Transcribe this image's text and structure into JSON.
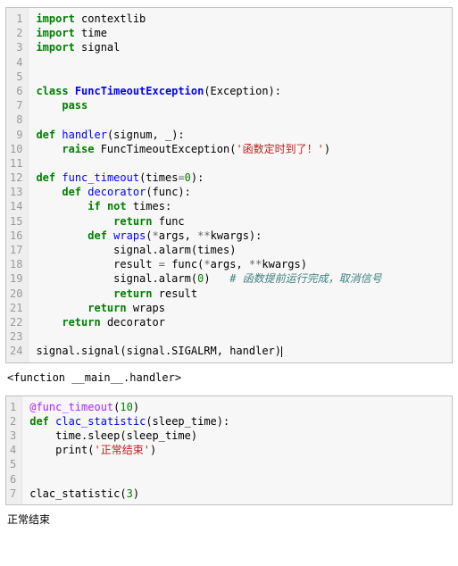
{
  "cells": [
    {
      "lines": [
        [
          [
            "kw",
            "import"
          ],
          [
            "pl",
            " contextlib"
          ]
        ],
        [
          [
            "kw",
            "import"
          ],
          [
            "pl",
            " time"
          ]
        ],
        [
          [
            "kw",
            "import"
          ],
          [
            "pl",
            " signal"
          ]
        ],
        [],
        [],
        [
          [
            "kw",
            "class"
          ],
          [
            "pl",
            " "
          ],
          [
            "cls",
            "FuncTimeoutException"
          ],
          [
            "pl",
            "(Exception):"
          ]
        ],
        [
          [
            "pl",
            "    "
          ],
          [
            "kw",
            "pass"
          ]
        ],
        [],
        [
          [
            "kw",
            "def"
          ],
          [
            "pl",
            " "
          ],
          [
            "fn",
            "handler"
          ],
          [
            "pl",
            "(signum, _):"
          ]
        ],
        [
          [
            "pl",
            "    "
          ],
          [
            "kw",
            "raise"
          ],
          [
            "pl",
            " FuncTimeoutException("
          ],
          [
            "str",
            "'函数定时到了！'"
          ],
          [
            "pl",
            ")"
          ]
        ],
        [],
        [
          [
            "kw",
            "def"
          ],
          [
            "pl",
            " "
          ],
          [
            "fn",
            "func_timeout"
          ],
          [
            "pl",
            "(times"
          ],
          [
            "op",
            "="
          ],
          [
            "num",
            "0"
          ],
          [
            "pl",
            "):"
          ]
        ],
        [
          [
            "pl",
            "    "
          ],
          [
            "kw",
            "def"
          ],
          [
            "pl",
            " "
          ],
          [
            "fn",
            "decorator"
          ],
          [
            "pl",
            "(func):"
          ]
        ],
        [
          [
            "pl",
            "        "
          ],
          [
            "kw",
            "if"
          ],
          [
            "pl",
            " "
          ],
          [
            "kw",
            "not"
          ],
          [
            "pl",
            " times:"
          ]
        ],
        [
          [
            "pl",
            "            "
          ],
          [
            "kw",
            "return"
          ],
          [
            "pl",
            " func"
          ]
        ],
        [
          [
            "pl",
            "        "
          ],
          [
            "kw",
            "def"
          ],
          [
            "pl",
            " "
          ],
          [
            "fn",
            "wraps"
          ],
          [
            "pl",
            "("
          ],
          [
            "op",
            "*"
          ],
          [
            "pl",
            "args, "
          ],
          [
            "op",
            "**"
          ],
          [
            "pl",
            "kwargs):"
          ]
        ],
        [
          [
            "pl",
            "            signal.alarm(times)"
          ]
        ],
        [
          [
            "pl",
            "            result "
          ],
          [
            "op",
            "="
          ],
          [
            "pl",
            " func("
          ],
          [
            "op",
            "*"
          ],
          [
            "pl",
            "args, "
          ],
          [
            "op",
            "**"
          ],
          [
            "pl",
            "kwargs)"
          ]
        ],
        [
          [
            "pl",
            "            signal.alarm("
          ],
          [
            "num",
            "0"
          ],
          [
            "pl",
            ")   "
          ],
          [
            "cmt",
            "# 函数提前运行完成，取消信号"
          ]
        ],
        [
          [
            "pl",
            "            "
          ],
          [
            "kw",
            "return"
          ],
          [
            "pl",
            " result"
          ]
        ],
        [
          [
            "pl",
            "        "
          ],
          [
            "kw",
            "return"
          ],
          [
            "pl",
            " wraps"
          ]
        ],
        [
          [
            "pl",
            "    "
          ],
          [
            "kw",
            "return"
          ],
          [
            "pl",
            " decorator"
          ]
        ],
        [],
        [
          [
            "pl",
            "signal.signal(signal.SIGALRM, handler)"
          ],
          [
            "cursor",
            ""
          ]
        ]
      ],
      "output": "<function __main__.handler>"
    },
    {
      "lines": [
        [
          [
            "dec",
            "@func_timeout"
          ],
          [
            "pl",
            "("
          ],
          [
            "num",
            "10"
          ],
          [
            "pl",
            ")"
          ]
        ],
        [
          [
            "kw",
            "def"
          ],
          [
            "pl",
            " "
          ],
          [
            "fn",
            "clac_statistic"
          ],
          [
            "pl",
            "(sleep_time):"
          ]
        ],
        [
          [
            "pl",
            "    time.sleep(sleep_time)"
          ]
        ],
        [
          [
            "pl",
            "    print("
          ],
          [
            "str",
            "'正常结束'"
          ],
          [
            "pl",
            ")"
          ]
        ],
        [],
        [],
        [
          [
            "pl",
            "clac_statistic("
          ],
          [
            "num",
            "3"
          ],
          [
            "pl",
            ")"
          ]
        ]
      ],
      "output": "正常结束"
    }
  ],
  "chart_data": {
    "type": "table",
    "title": "Python code cells and outputs",
    "cells": [
      {
        "code": "import contextlib\nimport time\nimport signal\n\n\nclass FuncTimeoutException(Exception):\n    pass\n\ndef handler(signum, _):\n    raise FuncTimeoutException('函数定时到了！')\n\ndef func_timeout(times=0):\n    def decorator(func):\n        if not times:\n            return func\n        def wraps(*args, **kwargs):\n            signal.alarm(times)\n            result = func(*args, **kwargs)\n            signal.alarm(0)   # 函数提前运行完成，取消信号\n            return result\n        return wraps\n    return decorator\n\nsignal.signal(signal.SIGALRM, handler)",
        "output": "<function __main__.handler>"
      },
      {
        "code": "@func_timeout(10)\ndef clac_statistic(sleep_time):\n    time.sleep(sleep_time)\n    print('正常结束')\n\n\nclac_statistic(3)",
        "output": "正常结束"
      }
    ]
  }
}
